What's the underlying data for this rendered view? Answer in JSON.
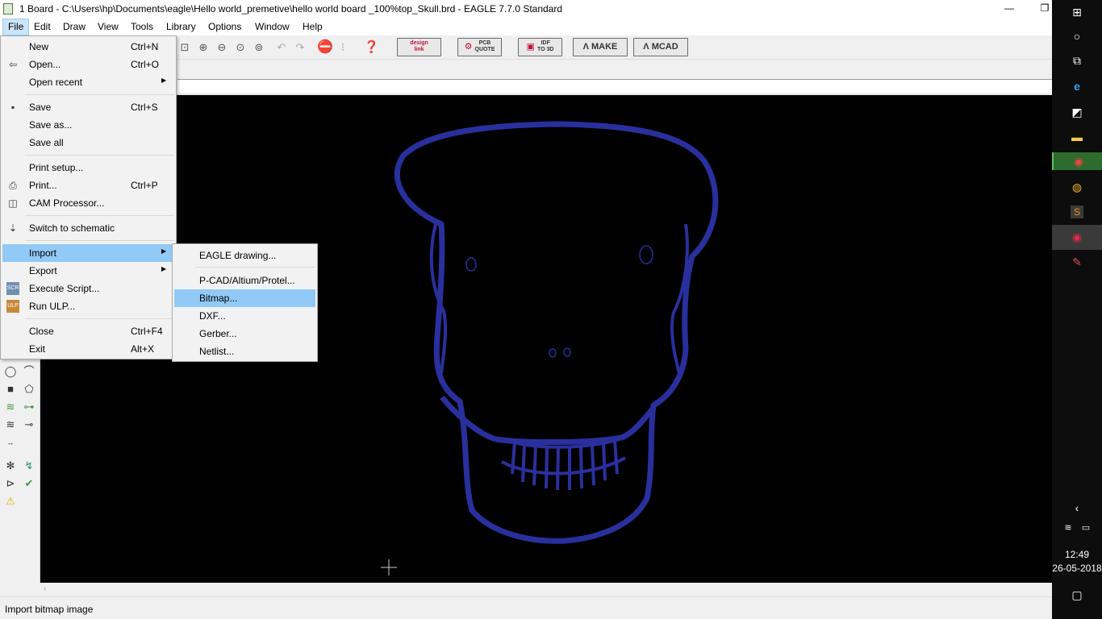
{
  "window": {
    "title": "1 Board - C:\\Users\\hp\\Documents\\eagle\\Hello world_premetive\\hello world board _100%top_Skull.brd - EAGLE 7.7.0 Standard",
    "minimize": "—",
    "restore": "❐",
    "close": "✕"
  },
  "menubar": [
    "File",
    "Edit",
    "Draw",
    "View",
    "Tools",
    "Library",
    "Options",
    "Window",
    "Help"
  ],
  "toolbar": {
    "design_link": [
      "design",
      "link"
    ],
    "pcb_quote": [
      "PCB",
      "QUOTE"
    ],
    "idf_to_3d": [
      "IDF",
      "TO 3D"
    ],
    "make": "MAKE",
    "mcad": "MCAD"
  },
  "file_menu": {
    "items": [
      {
        "label": "New",
        "shortcut": "Ctrl+N",
        "icon": "new-icon"
      },
      {
        "label": "Open...",
        "shortcut": "Ctrl+O",
        "icon": "open-icon"
      },
      {
        "label": "Open recent",
        "shortcut": "",
        "icon": "",
        "submenu": true
      },
      {
        "label": "Save",
        "shortcut": "Ctrl+S",
        "icon": "save-icon"
      },
      {
        "label": "Save as...",
        "shortcut": "",
        "icon": ""
      },
      {
        "label": "Save all",
        "shortcut": "",
        "icon": ""
      },
      {
        "label": "Print setup...",
        "shortcut": "",
        "icon": ""
      },
      {
        "label": "Print...",
        "shortcut": "Ctrl+P",
        "icon": "print-icon"
      },
      {
        "label": "CAM Processor...",
        "shortcut": "",
        "icon": "cam-icon"
      },
      {
        "label": "Switch to schematic",
        "shortcut": "",
        "icon": "switch-icon"
      },
      {
        "label": "Import",
        "shortcut": "",
        "icon": "",
        "submenu": true
      },
      {
        "label": "Export",
        "shortcut": "",
        "icon": "",
        "submenu": true
      },
      {
        "label": "Execute Script...",
        "shortcut": "",
        "icon": "script-icon",
        "icon_text": "SCR"
      },
      {
        "label": "Run ULP...",
        "shortcut": "",
        "icon": "ulp-icon",
        "icon_text": "ULP"
      },
      {
        "label": "Close",
        "shortcut": "Ctrl+F4",
        "icon": ""
      },
      {
        "label": "Exit",
        "shortcut": "Alt+X",
        "icon": ""
      }
    ]
  },
  "import_submenu": {
    "items": [
      "EAGLE drawing...",
      "P-CAD/Altium/Protel...",
      "Bitmap...",
      "DXF...",
      "Gerber...",
      "Netlist..."
    ],
    "highlighted": "Bitmap..."
  },
  "status_bar": {
    "text": "Import bitmap image"
  },
  "taskbar": {
    "time": "12:49",
    "date": "26-05-2018"
  },
  "colors": {
    "skull_outline": "#2a2f9e",
    "canvas": "#000000",
    "menu_highlight": "#91c9f7"
  }
}
